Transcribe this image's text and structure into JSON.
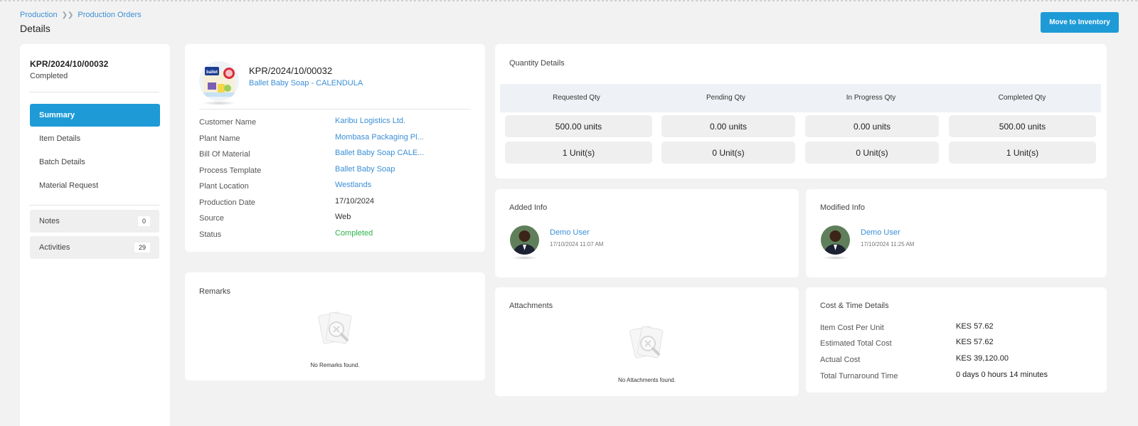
{
  "breadcrumb": [
    "Production",
    "Production Orders"
  ],
  "page_title": "Details",
  "actions": {
    "move_to_inventory": "Move to Inventory"
  },
  "sidebar": {
    "order_code": "KPR/2024/10/00032",
    "order_status": "Completed",
    "nav": [
      "Summary",
      "Item Details",
      "Batch Details",
      "Material Request"
    ],
    "notes": {
      "label": "Notes",
      "count": "0"
    },
    "activities": {
      "label": "Activities",
      "count": "29"
    }
  },
  "product": {
    "code": "KPR/2024/10/00032",
    "name": "Ballet Baby Soap - CALENDULA",
    "fields": [
      {
        "label": "Customer Name",
        "value": "Karibu Logistics Ltd."
      },
      {
        "label": "Plant Name",
        "value": "Mombasa Packaging Pl..."
      },
      {
        "label": "Bill Of Material",
        "value": "Ballet Baby Soap CALE..."
      },
      {
        "label": "Process Template",
        "value": "Ballet Baby Soap"
      },
      {
        "label": "Plant Location",
        "value": "Westlands"
      },
      {
        "label": "Production Date",
        "value": "17/10/2024"
      },
      {
        "label": "Source",
        "value": "Web"
      },
      {
        "label": "Status",
        "value": "Completed"
      }
    ],
    "image_text": "ballet"
  },
  "remarks": {
    "title": "Remarks",
    "empty": "No Remarks found."
  },
  "quantity": {
    "title": "Quantity Details",
    "headers": [
      "Requested Qty",
      "Pending Qty",
      "In Progress Qty",
      "Completed Qty"
    ],
    "rows": [
      [
        "500.00 units",
        "0.00 units",
        "0.00 units",
        "500.00 units"
      ],
      [
        "1 Unit(s)",
        "0 Unit(s)",
        "0 Unit(s)",
        "1 Unit(s)"
      ]
    ]
  },
  "added_info": {
    "title": "Added Info",
    "user": "Demo User",
    "time": "17/10/2024 11:07 AM"
  },
  "modified_info": {
    "title": "Modified Info",
    "user": "Demo User",
    "time": "17/10/2024 11:25 AM"
  },
  "attachments": {
    "title": "Attachments",
    "empty": "No Attachments found."
  },
  "cost": {
    "title": "Cost & Time Details",
    "rows": [
      {
        "label": "Item Cost Per Unit",
        "value": "KES 57.62"
      },
      {
        "label": "Estimated Total Cost",
        "value": "KES 57.62"
      },
      {
        "label": "Actual Cost",
        "value": "KES 39,120.00"
      },
      {
        "label": "Total Turnaround Time",
        "value": "0 days 0 hours 14 minutes"
      }
    ]
  },
  "colors": {
    "accent": "#1e9bd7",
    "link": "#3a8fd6",
    "success": "#2cb34a"
  }
}
